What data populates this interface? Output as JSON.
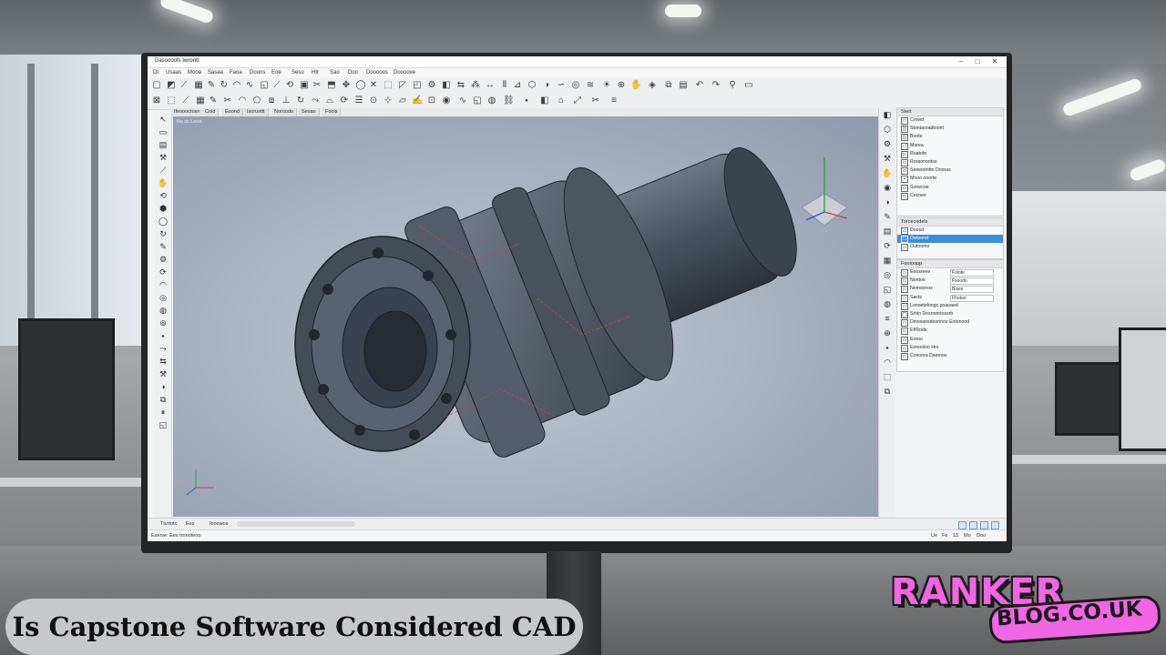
{
  "window": {
    "title": "Dasoooofs twrontt",
    "minimize": "–",
    "maximize": "□",
    "close": "✕"
  },
  "menu": [
    "Dt",
    "Usaas",
    "Mooa",
    "Sasaa",
    "Faoa",
    "Doons",
    "Eoe",
    "Seso",
    "Htr",
    "Sao",
    "Doo",
    "Dooooos",
    "Doooove"
  ],
  "tabs": [
    "Ifeoooctosn",
    "Cold",
    "Eoond",
    "Isorusttt",
    "Noroodo",
    "Sesao",
    "Foois"
  ],
  "viewport_label": "Ns sc Looo",
  "right_panel": {
    "tree_title": "Stert",
    "tree_rows": [
      {
        "icon": "□",
        "label": "Crowd"
      },
      {
        "icon": "◫",
        "label": "Stontaoradtoont"
      },
      {
        "icon": "◫",
        "label": "Booto"
      },
      {
        "icon": "□",
        "label": "Morea"
      },
      {
        "icon": "▷",
        "label": "Ruatofe"
      },
      {
        "icon": "▭",
        "label": "Roraonootse"
      },
      {
        "icon": "▭",
        "label": "Seeeoontto Dooras"
      },
      {
        "icon": "▪",
        "label": "Mnoo ooorte"
      },
      {
        "icon": "▭",
        "label": "Sonecoe"
      },
      {
        "icon": "□",
        "label": "Cesoes"
      }
    ],
    "props_title": "Torcecodels",
    "props_rows": [
      {
        "icon": "▭",
        "label": "Doosd",
        "selected": false
      },
      {
        "icon": "▭",
        "label": "Oeteond",
        "selected": true
      },
      {
        "icon": "▭",
        "label": "Outoomo",
        "selected": false
      }
    ],
    "params_title": "Footoopp",
    "params_rows": [
      {
        "icon": "▭",
        "label": "Eoosreee",
        "value": "Folote"
      },
      {
        "icon": "▭",
        "label": "Nontoe",
        "value": "Fsoodo"
      },
      {
        "icon": "▭",
        "label": "Nemsonos",
        "value": "Bises"
      },
      {
        "icon": "□",
        "label": "Sacts",
        "value": "Fhotoo"
      }
    ],
    "extra_rows": [
      {
        "icon": "□",
        "label": "Lonoetelongs poaoaed"
      },
      {
        "icon": "◯",
        "label": "Srhin Dosoonrtossrb"
      },
      {
        "icon": "□",
        "label": "Dinoxansdoonnos Eotonood"
      },
      {
        "icon": "▭",
        "label": "Ef/Rods"
      },
      {
        "icon": "▭",
        "label": "Erooo"
      },
      {
        "icon": "▭",
        "label": "Eonooloo Hrs"
      },
      {
        "icon": "□",
        "label": "Cosoora Damnos"
      }
    ]
  },
  "statusbar": {
    "left_label": "Ttvrtotc",
    "left_value": "Ees",
    "mode": "Iboowos",
    "bottom_left": "Eserve: Ees tronoteoo",
    "bottom_right": [
      "Ue",
      "Fe",
      "13",
      "Mo",
      "Doo"
    ]
  },
  "caption": "Is Capstone Software Considered CAD",
  "logo": {
    "line1": "RANKER",
    "line2": "BLOG.CO.UK"
  },
  "colors": {
    "accent_select": "#3b8edb",
    "logo_pink": "#f066e3",
    "viewport": "#aeb7c6"
  }
}
